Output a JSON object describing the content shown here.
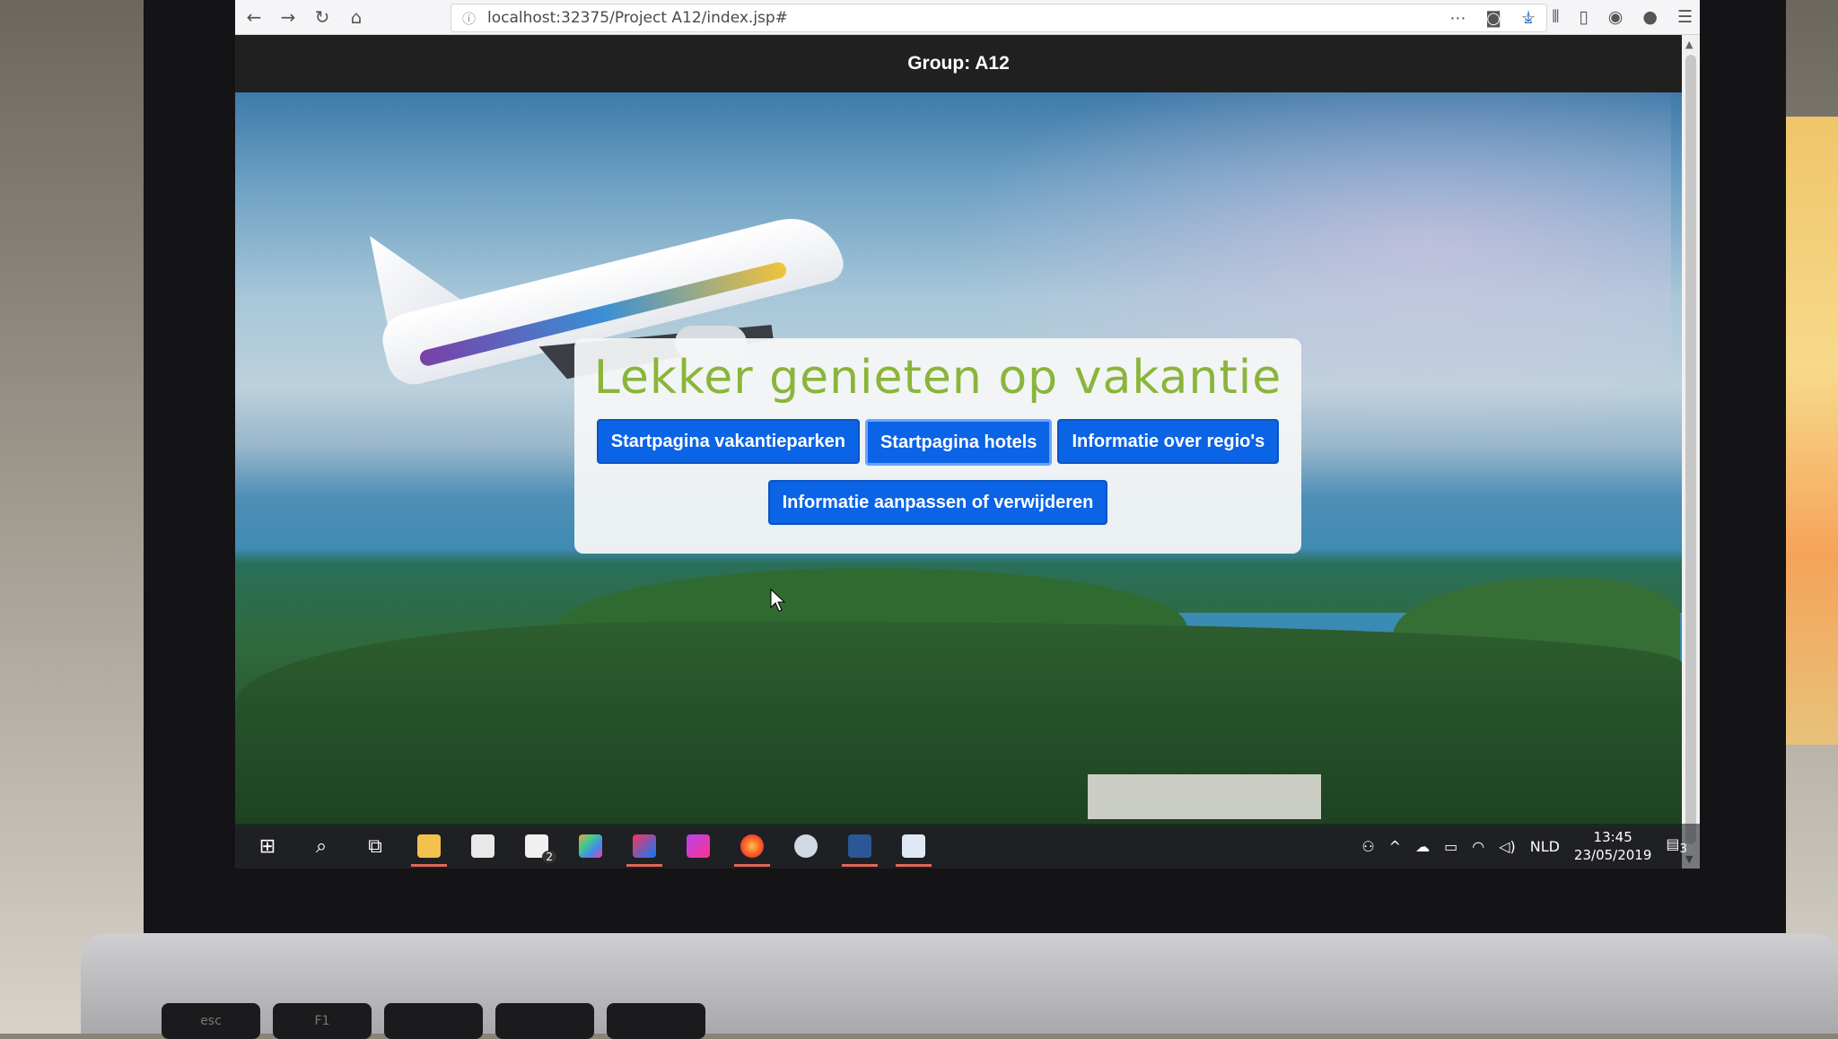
{
  "browser": {
    "url": "localhost:32375/Project A12/index.jsp#",
    "nav": {
      "back": "←",
      "forward": "→",
      "reload": "↻",
      "home": "⌂"
    },
    "url_icons": [
      "⋯",
      "◙",
      "☆"
    ],
    "toolbar_icons": [
      "⤓",
      "⫴",
      "▯",
      "◉",
      "●",
      "☰"
    ]
  },
  "page": {
    "header": "Group: A12",
    "title": "Lekker genieten op vakantie",
    "buttons": [
      "Startpagina vakantieparken",
      "Startpagina hotels",
      "Informatie over regio's",
      "Informatie aanpassen of verwijderen"
    ]
  },
  "taskbar": {
    "start_icon": "⊞",
    "search_icon": "⌕",
    "taskview_icon": "⧉",
    "mail_badge": "2",
    "tray": {
      "language": "NLD",
      "time": "13:45",
      "date": "23/05/2019",
      "notification_count": "3"
    }
  },
  "keyboard": {
    "esc": "esc",
    "f1": "F1"
  }
}
